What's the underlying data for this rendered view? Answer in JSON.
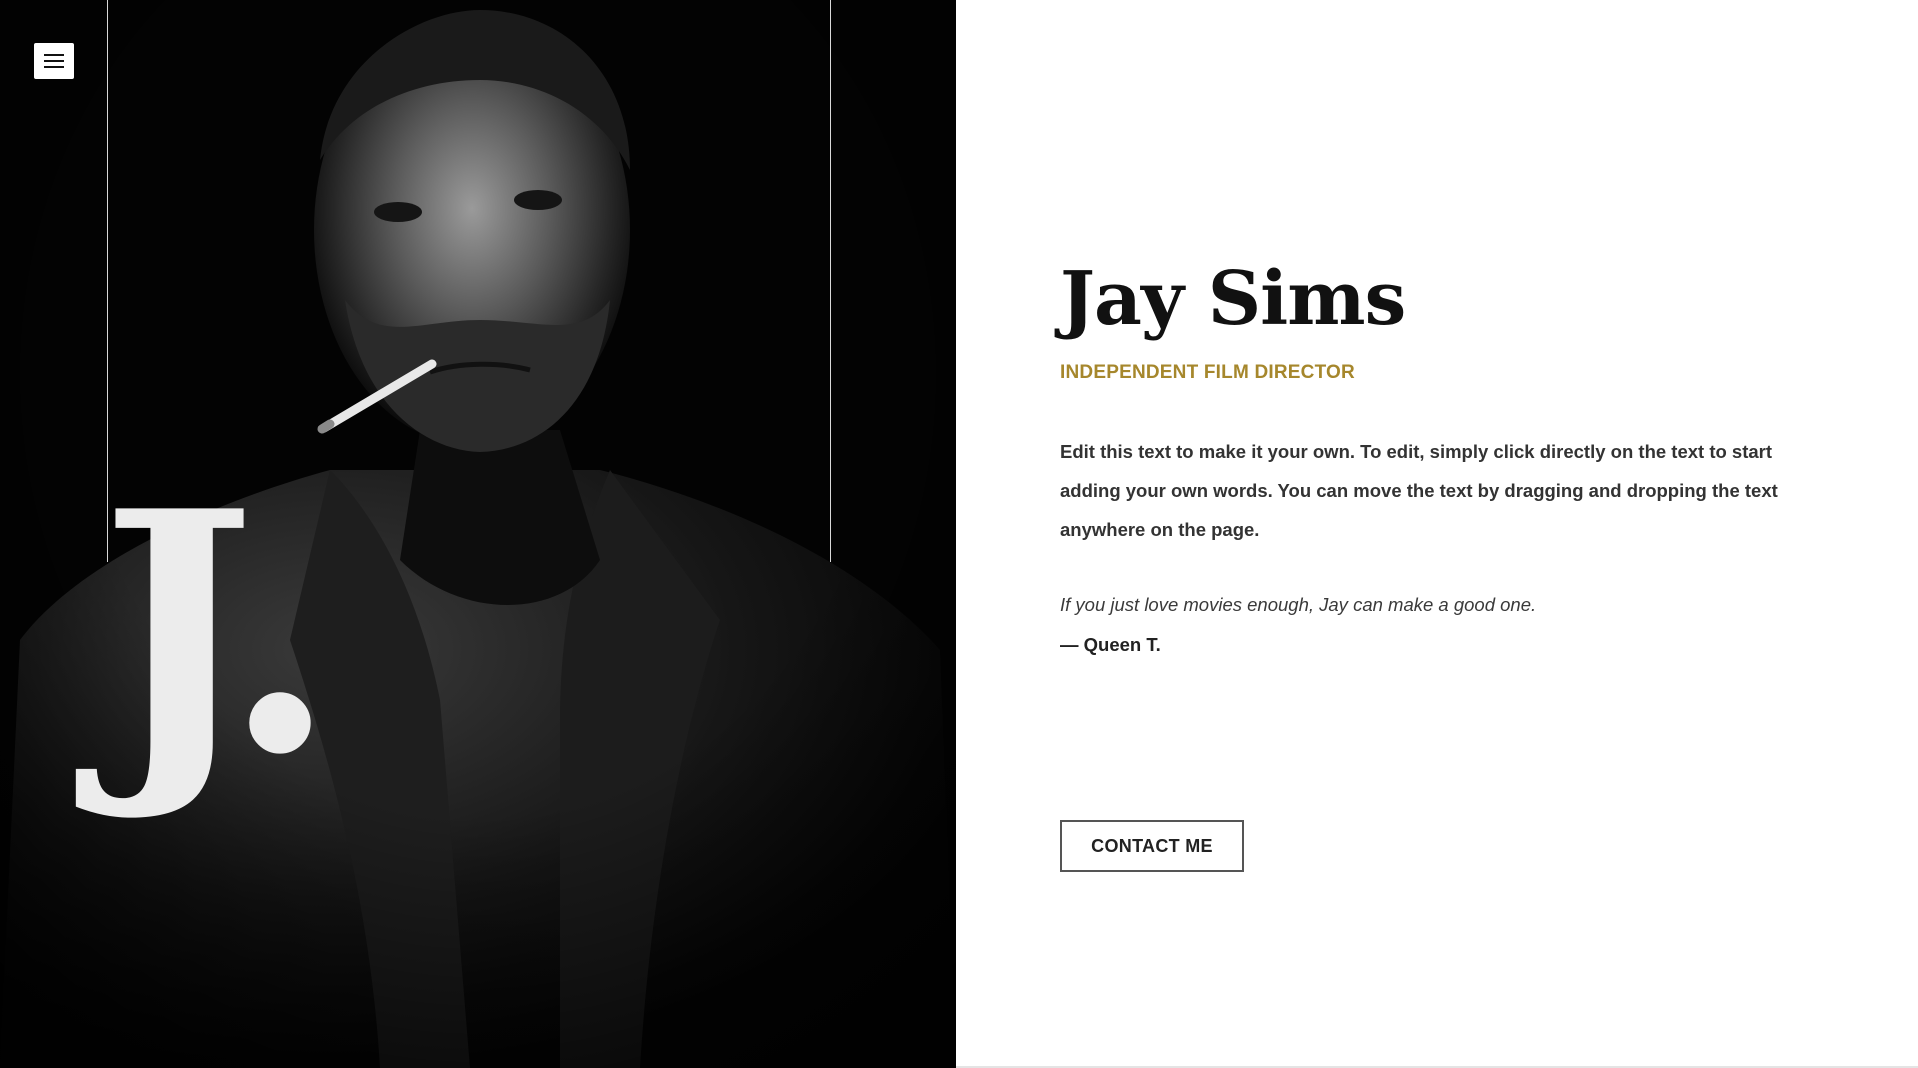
{
  "menu": {
    "icon": "hamburger-menu-icon"
  },
  "hero": {
    "image": "black-and-white-portrait-man-with-cigarette",
    "monogram": "J."
  },
  "profile": {
    "name": "Jay Sims",
    "role": "INDEPENDENT FILM DIRECTOR",
    "bio": "Edit this text to make it your own. To edit, simply click directly on the text to start adding your own words. You can move the text by dragging and dropping the text anywhere on the page.",
    "quote": "If you just love movies enough, Jay can make a good one.",
    "quote_author": "— Queen T."
  },
  "cta": {
    "label": "CONTACT ME"
  },
  "colors": {
    "left_panel_bg": "#030303",
    "right_panel_bg": "#ffffff",
    "accent_gold": "#a6872c",
    "heading_text": "#111111",
    "body_text": "#333333"
  }
}
